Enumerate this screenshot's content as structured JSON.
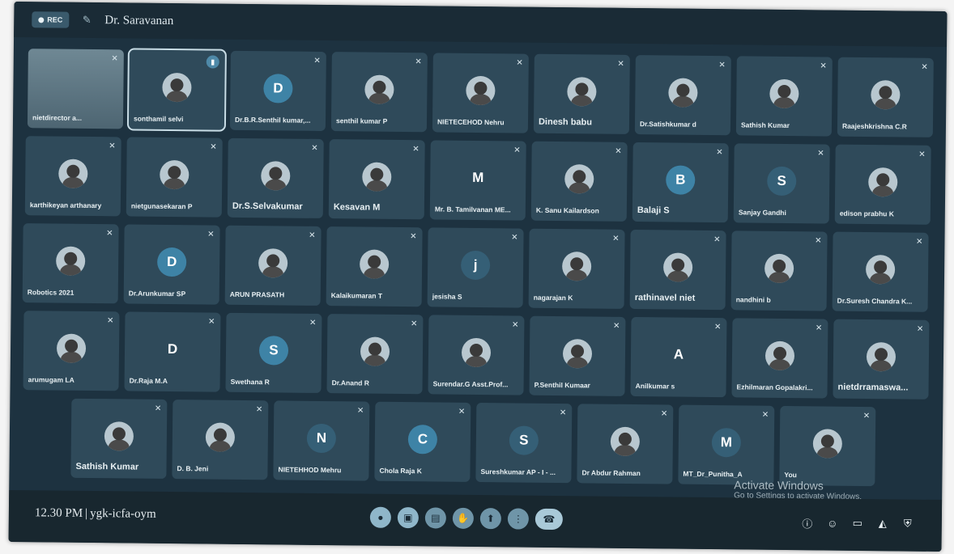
{
  "topbar": {
    "rec_label": "REC",
    "presenter_name": "Dr. Saravanan"
  },
  "participants": [
    [
      {
        "name": "nietdirector a...",
        "type": "video",
        "mic_muted": true
      },
      {
        "name": "sonthamil selvi",
        "type": "avatar",
        "speaking": true
      },
      {
        "name": "Dr.B.R.Senthil kumar,...",
        "type": "letter",
        "letter": "D",
        "color": "#3e83a6"
      },
      {
        "name": "senthil kumar P",
        "type": "avatar"
      },
      {
        "name": "NIETECEHOD Nehru",
        "type": "avatar"
      },
      {
        "name": "Dinesh babu",
        "type": "avatar",
        "big": true
      },
      {
        "name": "Dr.Satishkumar d",
        "type": "avatar"
      },
      {
        "name": "Sathish Kumar",
        "type": "avatar"
      },
      {
        "name": "Raajeshkrishna C.R",
        "type": "avatar"
      }
    ],
    [
      {
        "name": "karthikeyan arthanary",
        "type": "avatar"
      },
      {
        "name": "nietgunasekaran P",
        "type": "avatar"
      },
      {
        "name": "Dr.S.Selvakumar",
        "type": "avatar",
        "big": true
      },
      {
        "name": "Kesavan M",
        "type": "avatar",
        "big": true
      },
      {
        "name": "Mr. B. Tamilvanan ME...",
        "type": "letter",
        "letter": "M",
        "color": "transparent"
      },
      {
        "name": "K. Sanu Kailardson",
        "type": "avatar"
      },
      {
        "name": "Balaji S",
        "type": "letter",
        "letter": "B",
        "color": "#3e83a6",
        "big": true
      },
      {
        "name": "Sanjay Gandhi",
        "type": "letter",
        "letter": "S",
        "color": "#355f76"
      },
      {
        "name": "edison prabhu K",
        "type": "avatar"
      }
    ],
    [
      {
        "name": "Robotics 2021",
        "type": "avatar"
      },
      {
        "name": "Dr.Arunkumar SP",
        "type": "letter",
        "letter": "D",
        "color": "#3e83a6"
      },
      {
        "name": "ARUN PRASATH",
        "type": "avatar"
      },
      {
        "name": "Kalaikumaran T",
        "type": "avatar"
      },
      {
        "name": "jesisha S",
        "type": "letter",
        "letter": "j",
        "color": "#355f76"
      },
      {
        "name": "nagarajan K",
        "type": "avatar"
      },
      {
        "name": "rathinavel niet",
        "type": "avatar",
        "big": true
      },
      {
        "name": "nandhini b",
        "type": "avatar"
      },
      {
        "name": "Dr.Suresh Chandra K...",
        "type": "avatar"
      }
    ],
    [
      {
        "name": "arumugam LA",
        "type": "avatar"
      },
      {
        "name": "Dr.Raja M.A",
        "type": "letter",
        "letter": "D",
        "color": "transparent"
      },
      {
        "name": "Swethana R",
        "type": "letter",
        "letter": "S",
        "color": "#3e83a6"
      },
      {
        "name": "Dr.Anand R",
        "type": "avatar"
      },
      {
        "name": "Surendar.G Asst.Prof...",
        "type": "avatar"
      },
      {
        "name": "P.Senthil Kumaar",
        "type": "avatar"
      },
      {
        "name": "Anilkumar s",
        "type": "letter",
        "letter": "A",
        "color": "transparent"
      },
      {
        "name": "Ezhilmaran Gopalakri...",
        "type": "avatar"
      },
      {
        "name": "nietdrramaswa...",
        "type": "avatar",
        "big": true
      }
    ],
    [
      {
        "name": "Sathish Kumar",
        "type": "avatar",
        "big": true
      },
      {
        "name": "D. B. Jeni",
        "type": "avatar"
      },
      {
        "name": "NIETEHHOD Mehru",
        "type": "letter",
        "letter": "N",
        "color": "#355f76"
      },
      {
        "name": "Chola Raja K",
        "type": "letter",
        "letter": "C",
        "color": "#3e83a6"
      },
      {
        "name": "Sureshkumar AP - I - ...",
        "type": "letter",
        "letter": "S",
        "color": "#355f76"
      },
      {
        "name": "Dr Abdur Rahman",
        "type": "avatar"
      },
      {
        "name": "MT_Dr_Punitha_A",
        "type": "letter",
        "letter": "M",
        "color": "#355f76"
      },
      {
        "name": "You",
        "type": "avatar"
      }
    ]
  ],
  "watermark": {
    "title": "Activate Windows",
    "subtitle": "Go to Settings to activate Windows."
  },
  "bottombar": {
    "time": "12.30 PM",
    "separator": "|",
    "meeting_code": "ygk-icfa-oym",
    "controls": [
      "mic-icon",
      "camera-icon",
      "captions-icon",
      "raise-hand-icon",
      "present-icon",
      "more-icon",
      "end-call-icon"
    ],
    "right_icons": [
      "info-icon",
      "people-icon",
      "chat-icon",
      "activities-icon",
      "host-controls-icon"
    ]
  },
  "colors": {
    "background": "#1d3240",
    "tile": "#2f4a5a",
    "control": "#8fb6c9"
  }
}
